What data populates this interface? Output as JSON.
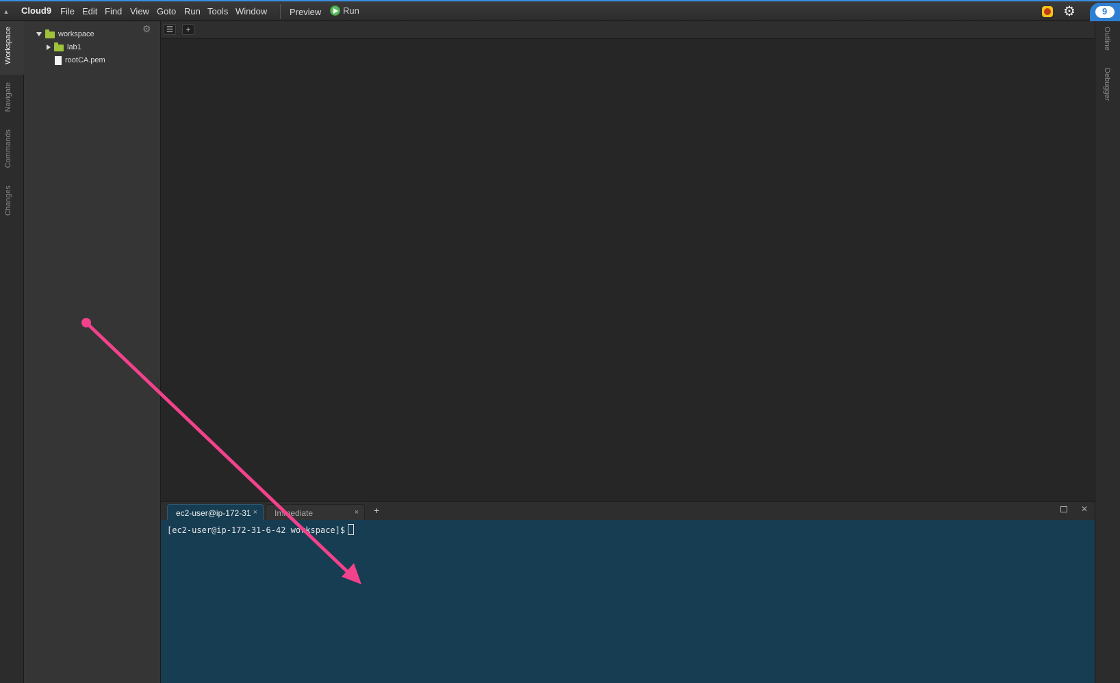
{
  "app": {
    "brand": "Cloud9",
    "menus": [
      "File",
      "Edit",
      "Find",
      "View",
      "Goto",
      "Run",
      "Tools",
      "Window"
    ],
    "preview_label": "Preview",
    "run_label": "Run",
    "cloud_badge": "9"
  },
  "left_tabs": [
    "Workspace",
    "Navigate",
    "Commands",
    "Changes"
  ],
  "right_tabs": [
    "Outline",
    "Debugger"
  ],
  "tree": {
    "root": "workspace",
    "items": [
      "lab1",
      "rootCA.pem"
    ]
  },
  "terminal": {
    "tabs": [
      {
        "label": "ec2-user@ip-172-31",
        "close": "×"
      },
      {
        "label": "Immediate",
        "close": "×"
      }
    ],
    "add_label": "+",
    "close_label": "✕",
    "prompt": "[ec2-user@ip-172-31-6-42 workspace]$"
  },
  "editor": {
    "add_label": "+"
  },
  "colors": {
    "accent": "#3a8ee6",
    "terminal_bg": "#173d52",
    "annotation": "#f2428b",
    "folder": "#9ec23a"
  }
}
